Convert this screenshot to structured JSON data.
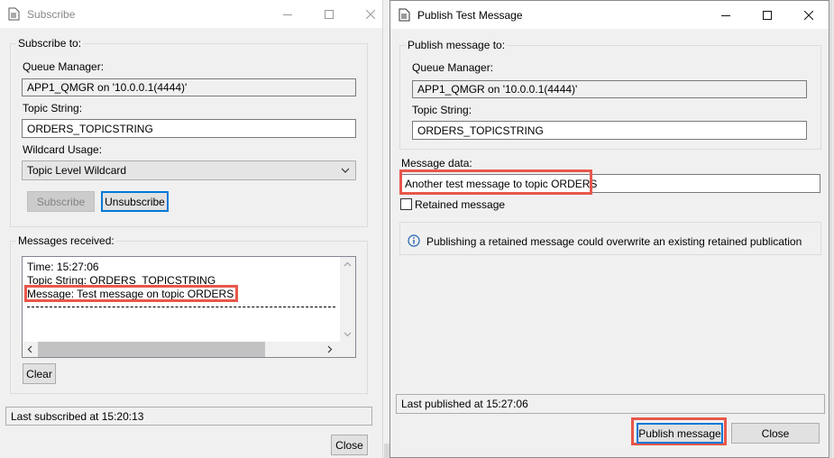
{
  "subscribe_window": {
    "title": "Subscribe",
    "group_title": "Subscribe to:",
    "queue_manager_label": "Queue Manager:",
    "queue_manager_value": "APP1_QMGR on '10.0.0.1(4444)'",
    "topic_string_label": "Topic String:",
    "topic_string_value": "ORDERS_TOPICSTRING",
    "wildcard_label": "Wildcard Usage:",
    "wildcard_selected": "Topic Level Wildcard",
    "subscribe_button": "Subscribe",
    "unsubscribe_button": "Unsubscribe",
    "messages_group_title": "Messages received:",
    "messages": {
      "time": "Time: 15:27:06",
      "topic": "Topic String: ORDERS_TOPICSTRING",
      "message": "Message: Test message on topic ORDERS"
    },
    "clear_button": "Clear",
    "status": "Last subscribed at 15:20:13",
    "close_button": "Close"
  },
  "publish_window": {
    "title": "Publish Test Message",
    "group_title": "Publish message to:",
    "queue_manager_label": "Queue Manager:",
    "queue_manager_value": "APP1_QMGR on '10.0.0.1(4444)'",
    "topic_string_label": "Topic String:",
    "topic_string_value": "ORDERS_TOPICSTRING",
    "message_data_label": "Message data:",
    "message_data_value": "Another test message to topic ORDERS",
    "retained_label": "Retained message",
    "retained_checked": false,
    "info_text": "Publishing a retained message could overwrite an existing retained publication",
    "status": "Last published at 15:27:06",
    "publish_button": "Publish message",
    "close_button": "Close"
  },
  "colors": {
    "highlight": "#e8574b",
    "focus": "#0078d7",
    "info_icon": "#1a5fb4"
  }
}
